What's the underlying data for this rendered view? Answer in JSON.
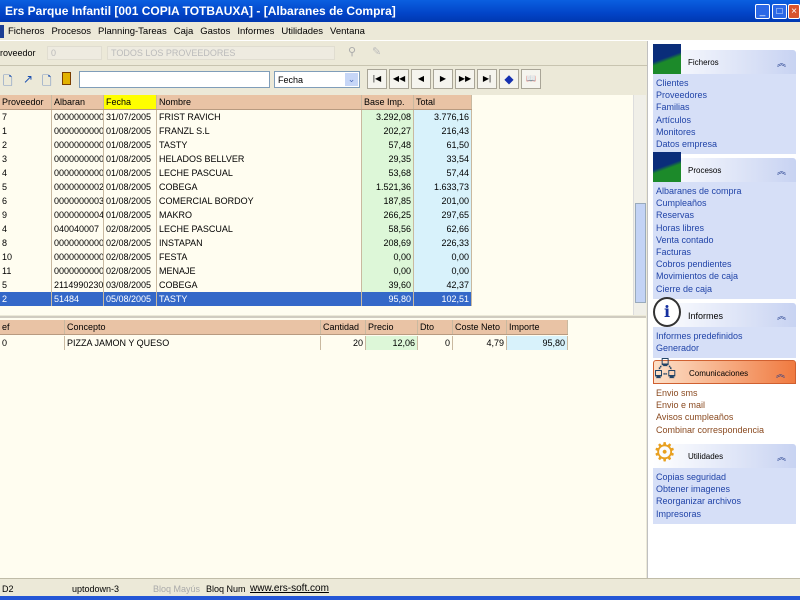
{
  "window": {
    "title": "Ers Parque Infantil [001 COPIA TOTBAUXA] - [Albaranes de Compra]"
  },
  "menu": [
    "Ficheros",
    "Procesos",
    "Planning-Tareas",
    "Caja",
    "Gastos",
    "Informes",
    "Utilidades",
    "Ventana"
  ],
  "filter": {
    "label": "roveedor",
    "code": "0",
    "name": "TODOS LOS PROVEEDORES"
  },
  "toolbar": {
    "search_value": "",
    "order_select": "Fecha"
  },
  "albaranes": {
    "columns": [
      "Proveedor",
      "Albaran",
      "Fecha",
      "Nombre",
      "Base Imp.",
      "Total"
    ],
    "rows": [
      [
        "7",
        "0000000000",
        "31/07/2005",
        "FRIST RAVICH",
        "3.292,08",
        "3.776,16"
      ],
      [
        "1",
        "0000000000",
        "01/08/2005",
        "FRANZL S.L",
        "202,27",
        "216,43"
      ],
      [
        "2",
        "0000000000",
        "01/08/2005",
        "TASTY",
        "57,48",
        "61,50"
      ],
      [
        "3",
        "0000000000",
        "01/08/2005",
        "HELADOS BELLVER",
        "29,35",
        "33,54"
      ],
      [
        "4",
        "0000000000",
        "01/08/2005",
        "LECHE PASCUAL",
        "53,68",
        "57,44"
      ],
      [
        "5",
        "0000000002",
        "01/08/2005",
        "COBEGA",
        "1.521,36",
        "1.633,73"
      ],
      [
        "6",
        "0000000003",
        "01/08/2005",
        "COMERCIAL BORDOY",
        "187,85",
        "201,00"
      ],
      [
        "9",
        "0000000004",
        "01/08/2005",
        "MAKRO",
        "266,25",
        "297,65"
      ],
      [
        "4",
        "040040007",
        "02/08/2005",
        "LECHE PASCUAL",
        "58,56",
        "62,66"
      ],
      [
        "8",
        "0000000000",
        "02/08/2005",
        "INSTAPAN",
        "208,69",
        "226,33"
      ],
      [
        "10",
        "0000000000",
        "02/08/2005",
        "FESTA",
        "0,00",
        "0,00"
      ],
      [
        "11",
        "0000000000",
        "02/08/2005",
        "MENAJE",
        "0,00",
        "0,00"
      ],
      [
        "5",
        "2114990230",
        "03/08/2005",
        "COBEGA",
        "39,60",
        "42,37"
      ],
      [
        "2",
        "51484",
        "05/08/2005",
        "TASTY",
        "95,80",
        "102,51"
      ]
    ],
    "selected_index": 13
  },
  "lineas": {
    "columns": [
      "ef",
      "Concepto",
      "Cantidad",
      "Precio",
      "Dto",
      "Coste Neto",
      "Importe"
    ],
    "rows": [
      [
        "0",
        "PIZZA JAMON Y QUESO",
        "20",
        "12,06",
        "0",
        "4,79",
        "95,80"
      ]
    ]
  },
  "sidebar": [
    {
      "title": "Ficheros",
      "items": [
        "Clientes",
        "Proveedores",
        "Familias",
        "Artículos",
        "Monitores",
        "Datos empresa"
      ]
    },
    {
      "title": "Procesos",
      "items": [
        "Albaranes de compra",
        "Cumpleaños",
        "Reservas",
        "Horas libres",
        "Venta contado",
        "Facturas",
        "Cobros pendientes",
        "Movimientos de caja",
        "Cierre de caja"
      ]
    },
    {
      "title": "Informes",
      "items": [
        "Informes predefinidos",
        "Generador"
      ]
    },
    {
      "title": "Comunicaciones",
      "items": [
        "Envio sms",
        "Envio e mail",
        "Avisos cumpleaños",
        "Combinar correspondencia"
      ]
    },
    {
      "title": "Utilidades",
      "items": [
        "Copias seguridad",
        "Obtener imagenes",
        "Reorganizar archivos",
        "Impresoras"
      ]
    }
  ],
  "status": {
    "db": "D2",
    "user": "uptodown-3",
    "caps": "Bloq Mayús",
    "num": "Bloq Num",
    "url": "www.ers-soft.com"
  }
}
